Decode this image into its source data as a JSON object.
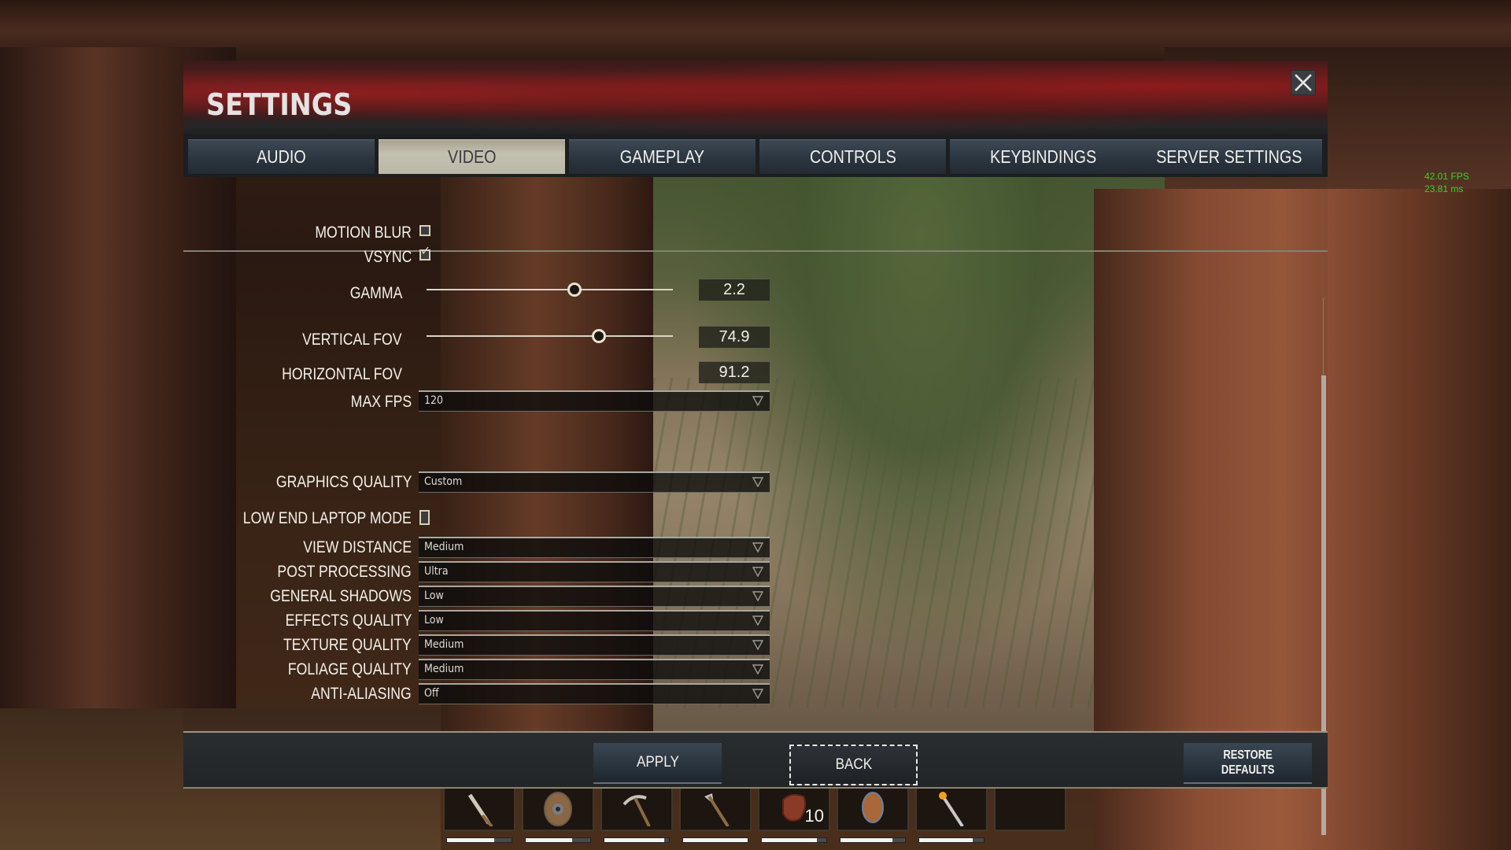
{
  "overlay": {
    "fps": "42.01 FPS",
    "frame_time": "23.81 ms"
  },
  "panel": {
    "title": "SETTINGS",
    "close_icon": "close-icon"
  },
  "tabs": [
    {
      "label": "AUDIO",
      "active": false
    },
    {
      "label": "VIDEO",
      "active": true
    },
    {
      "label": "GAMEPLAY",
      "active": false
    },
    {
      "label": "CONTROLS",
      "active": false
    },
    {
      "label": "KEYBINDINGS",
      "active": false
    },
    {
      "label": "SERVER SETTINGS",
      "active": false
    }
  ],
  "video": {
    "motion_blur": {
      "label": "MOTION BLUR",
      "checked": false
    },
    "vsync": {
      "label": "VSYNC",
      "checked": true
    },
    "gamma": {
      "label": "GAMMA",
      "value": "2.2",
      "slider_fraction": 0.6
    },
    "vertical_fov": {
      "label": "VERTICAL FOV",
      "value": "74.9",
      "slider_fraction": 0.7
    },
    "horizontal_fov": {
      "label": "HORIZONTAL FOV",
      "value": "91.2"
    },
    "max_fps": {
      "label": "MAX FPS",
      "value": "120"
    },
    "graphics_quality": {
      "label": "GRAPHICS QUALITY",
      "value": "Custom"
    },
    "low_end_laptop_mode": {
      "label": "LOW END LAPTOP MODE",
      "checked": false
    },
    "quality_settings": [
      {
        "label": "VIEW DISTANCE",
        "value": "Medium"
      },
      {
        "label": "POST PROCESSING",
        "value": "Ultra"
      },
      {
        "label": "GENERAL SHADOWS",
        "value": "Low"
      },
      {
        "label": "EFFECTS QUALITY",
        "value": "Low"
      },
      {
        "label": "TEXTURE QUALITY",
        "value": "Medium"
      },
      {
        "label": "FOLIAGE QUALITY",
        "value": "Medium"
      },
      {
        "label": "ANTI-ALIASING",
        "value": "Off"
      }
    ]
  },
  "footer": {
    "apply_label": "APPLY",
    "back_label": "BACK",
    "restore_label_line1": "RESTORE",
    "restore_label_line2": "DEFAULTS"
  },
  "scrollbar": {
    "position_fraction": 1.0
  },
  "hotbar": {
    "slots": [
      {
        "item": "stone-sword-icon",
        "count": "",
        "durability": 0.73
      },
      {
        "item": "wooden-shield-icon",
        "count": "",
        "durability": 0.72
      },
      {
        "item": "stone-pickaxe-icon",
        "count": "",
        "durability": 0.93
      },
      {
        "item": "stone-hatchet-icon",
        "count": "",
        "durability": 1.0
      },
      {
        "item": "raw-meat-icon",
        "count": "10",
        "durability": 0.85
      },
      {
        "item": "seed-icon",
        "count": "",
        "durability": 0.8
      },
      {
        "item": "torch-icon",
        "count": "",
        "durability": 0.83
      },
      {
        "item": "empty-slot",
        "count": "",
        "durability": null
      }
    ]
  },
  "colors": {
    "fps_text": "#36d12c",
    "active_tab_bg": "#c4c0b0",
    "header_red": "#8a1e1e"
  }
}
